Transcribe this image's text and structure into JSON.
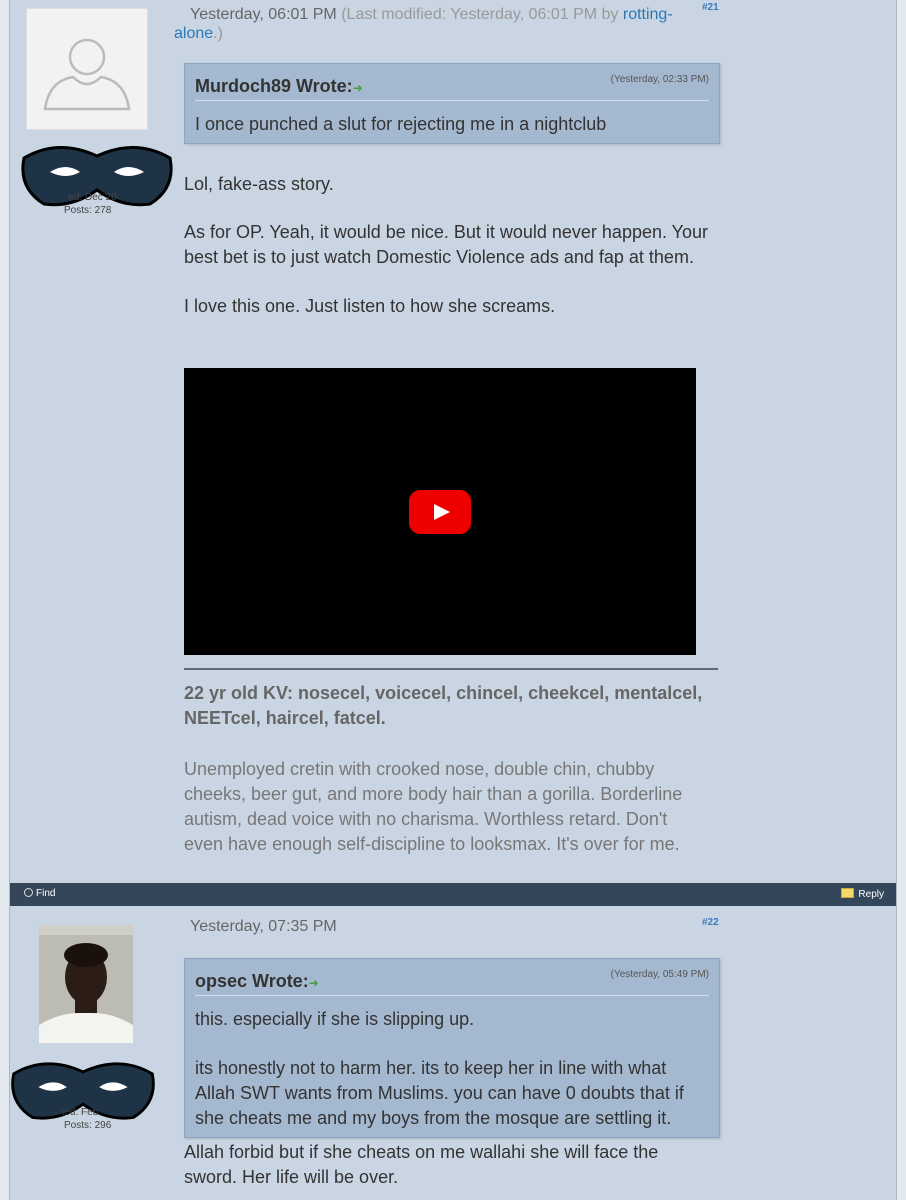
{
  "posts": [
    {
      "date": "Yesterday, 06:01 PM",
      "modified_prefix": "(Last modified: Yesterday, 06:01 PM by ",
      "modified_user_a": "rotting-",
      "modified_user_b": "alone",
      "modified_suffix": ".)",
      "number": "#21",
      "user_joined": "Joined: Dec 20",
      "user_posts": "Posts: 278",
      "quote": {
        "author": "Murdoch89 Wrote:",
        "time": "(Yesterday, 02:33 PM)",
        "lines": [
          "I once punched a slut for rejecting me in a nightclub"
        ]
      },
      "body": [
        "Lol, fake-ass story.",
        "As for OP. Yeah, it would be nice. But it would never happen. Your",
        "best bet is to just watch Domestic Violence ads and fap at them.",
        "I love this one. Just listen to how she screams."
      ],
      "signature_title_1": "22 yr old KV: nosecel, voicecel, chincel, cheekcel, mentalcel,",
      "signature_title_2": "NEETcel, haircel, fatcel.",
      "signature_lines": [
        "Unemployed cretin with crooked nose, double chin, chubby",
        "cheeks, beer gut, and more body hair than a gorilla. Borderline",
        "autism, dead voice with no charisma. Worthless retard. Don't",
        "even have enough self-discipline to looksmax. It's over for me."
      ]
    },
    {
      "date": "Yesterday, 07:35 PM",
      "number": "#22",
      "user_joined": "Joined: Feb",
      "user_posts": "Posts: 296",
      "quote": {
        "author": "opsec Wrote:",
        "time": "(Yesterday, 05:49 PM)",
        "lines": [
          "this. especially if she is slipping up.",
          "its honestly not to harm her. its to keep her in line with what",
          "Allah SWT wants from Muslims. you can have 0 doubts that if",
          "she cheats me and my boys from the mosque are settling it."
        ]
      },
      "body": [
        "Allah forbid but if she cheats on me wallahi she will face the",
        "sword. Her life will be over."
      ]
    }
  ],
  "toolbar": {
    "find_label": "Find",
    "reply_label": "Reply"
  },
  "colors": {
    "background": "#c9d5e3",
    "quote_bg": "#a4b8cf",
    "toolbar_bg": "#34465a",
    "link": "#2e77b5",
    "youtube_red": "#ee0000"
  },
  "icons": [
    "quote-arrow-icon",
    "youtube-play-icon",
    "find-icon",
    "reply-icon",
    "mask-icon"
  ]
}
